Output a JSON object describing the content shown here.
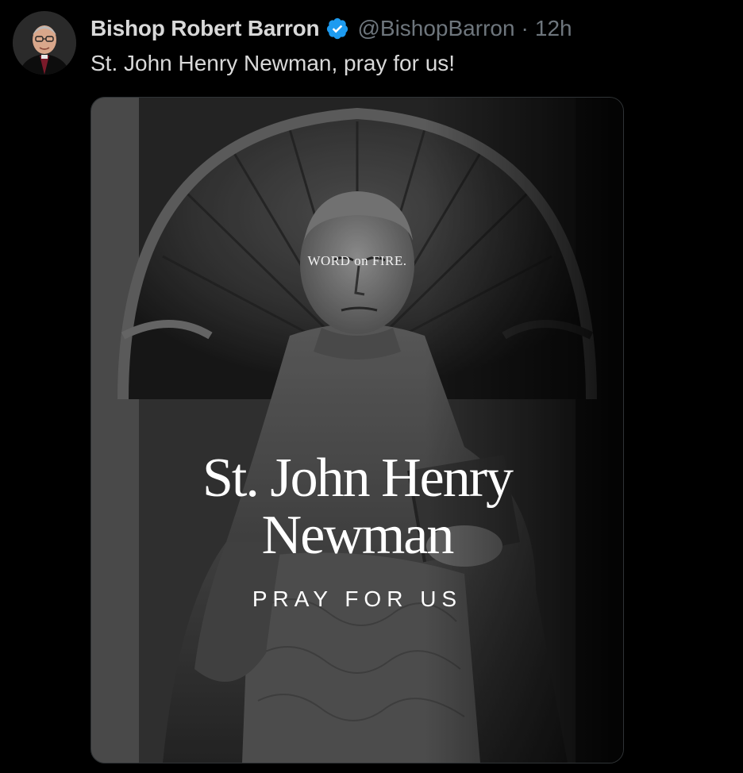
{
  "tweet": {
    "author_name": "Bishop Robert Barron",
    "handle": "@BishopBarron",
    "separator": "·",
    "time": "12h",
    "text": "St. John Henry Newman, pray for us!",
    "verified_icon": "verified-badge-icon",
    "verified_color": "#1d9bf0"
  },
  "media": {
    "brand": "WORD on FIRE.",
    "title_line1": "St. John Henry",
    "title_line2": "Newman",
    "subtitle": "PRAY FOR US"
  }
}
